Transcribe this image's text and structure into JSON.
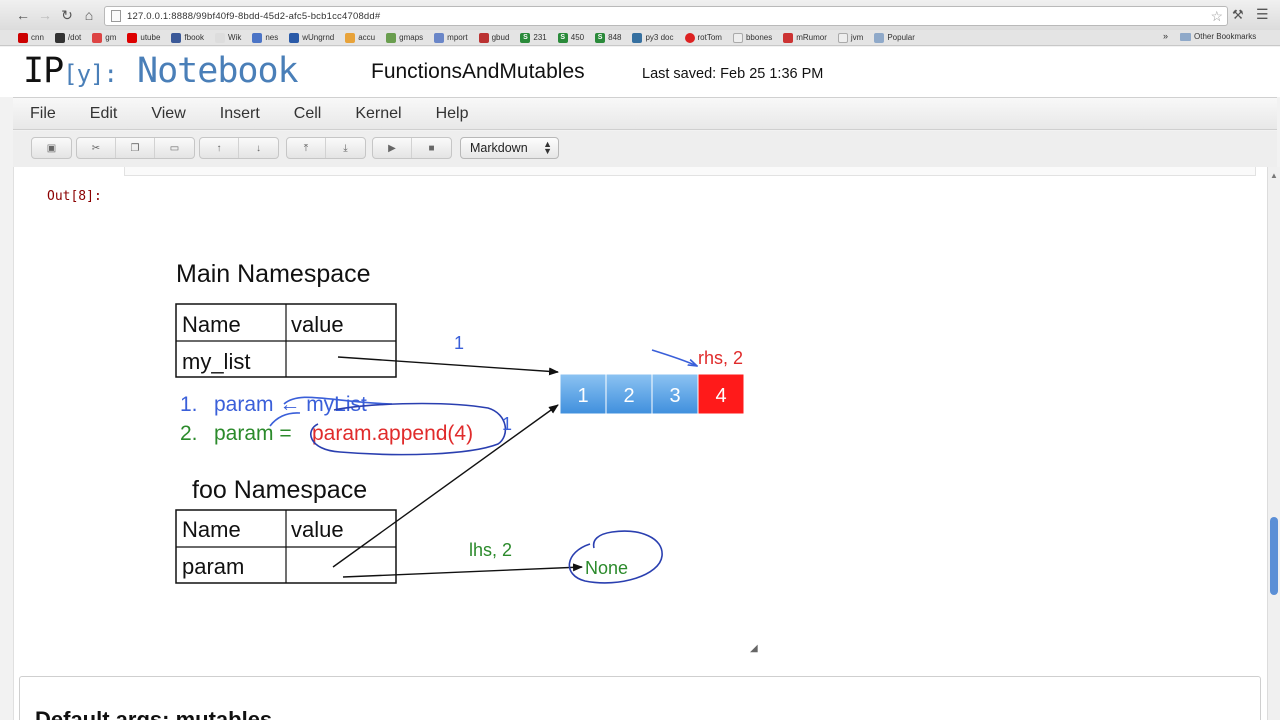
{
  "browser": {
    "url": "127.0.0.1:8888/99bf40f9-8bdd-45d2-afc5-bcb1cc4708dd#",
    "bookmarks": [
      "cnn",
      "/dot",
      "gm",
      "utube",
      "fbook",
      "Wik",
      "nes",
      "wUngrnd",
      "accu",
      "gmaps",
      "mport",
      "gbud",
      "231",
      "450",
      "848",
      "py3 doc",
      "rotTom",
      "bbones",
      "mRumor",
      "jvm",
      "Popular"
    ],
    "more": "»",
    "other_bookmarks": "Other Bookmarks"
  },
  "notebook": {
    "logo_ip": "IP",
    "logo_bracket": "[y]:",
    "logo_name": "Notebook",
    "title": "FunctionsAndMutables",
    "last_saved": "Last saved: Feb 25 1:36 PM"
  },
  "menu": [
    "File",
    "Edit",
    "View",
    "Insert",
    "Cell",
    "Kernel",
    "Help"
  ],
  "toolbar": {
    "cell_type": "Markdown",
    "icons": [
      "save-icon",
      "cut-icon",
      "copy-icon",
      "paste-icon",
      "move-up-icon",
      "move-down-icon",
      "insert-above-icon",
      "insert-below-icon",
      "run-icon",
      "stop-icon"
    ]
  },
  "output": {
    "prompt": "Out[8]:"
  },
  "diagram": {
    "main_namespace": {
      "title": "Main Namespace",
      "header": [
        "Name",
        "value"
      ],
      "row_name": "my_list"
    },
    "steps": {
      "step1_num": "1.",
      "step1_text": "param ← myList",
      "step2_num": "2.",
      "step2_lhs": "param =",
      "step2_rhs": "param.append(4)"
    },
    "foo_namespace": {
      "title": "foo Namespace",
      "header": [
        "Name",
        "value"
      ],
      "row_name": "param"
    },
    "list_values": [
      "1",
      "2",
      "3",
      "4"
    ],
    "annotations": {
      "arrow_label_1": "1",
      "rhs_label": "rhs, 2",
      "side_label_1": "1",
      "lhs_label": "lhs, 2",
      "none_value": "None"
    },
    "colors": {
      "list_blue": "#5a9de0",
      "list_red": "#ff1a1a",
      "hand_blue": "#3a5fd9",
      "hand_green": "#2b8a2b",
      "hand_red": "#e02b2b"
    }
  },
  "next_cell": {
    "heading": "Default args: mutables"
  }
}
